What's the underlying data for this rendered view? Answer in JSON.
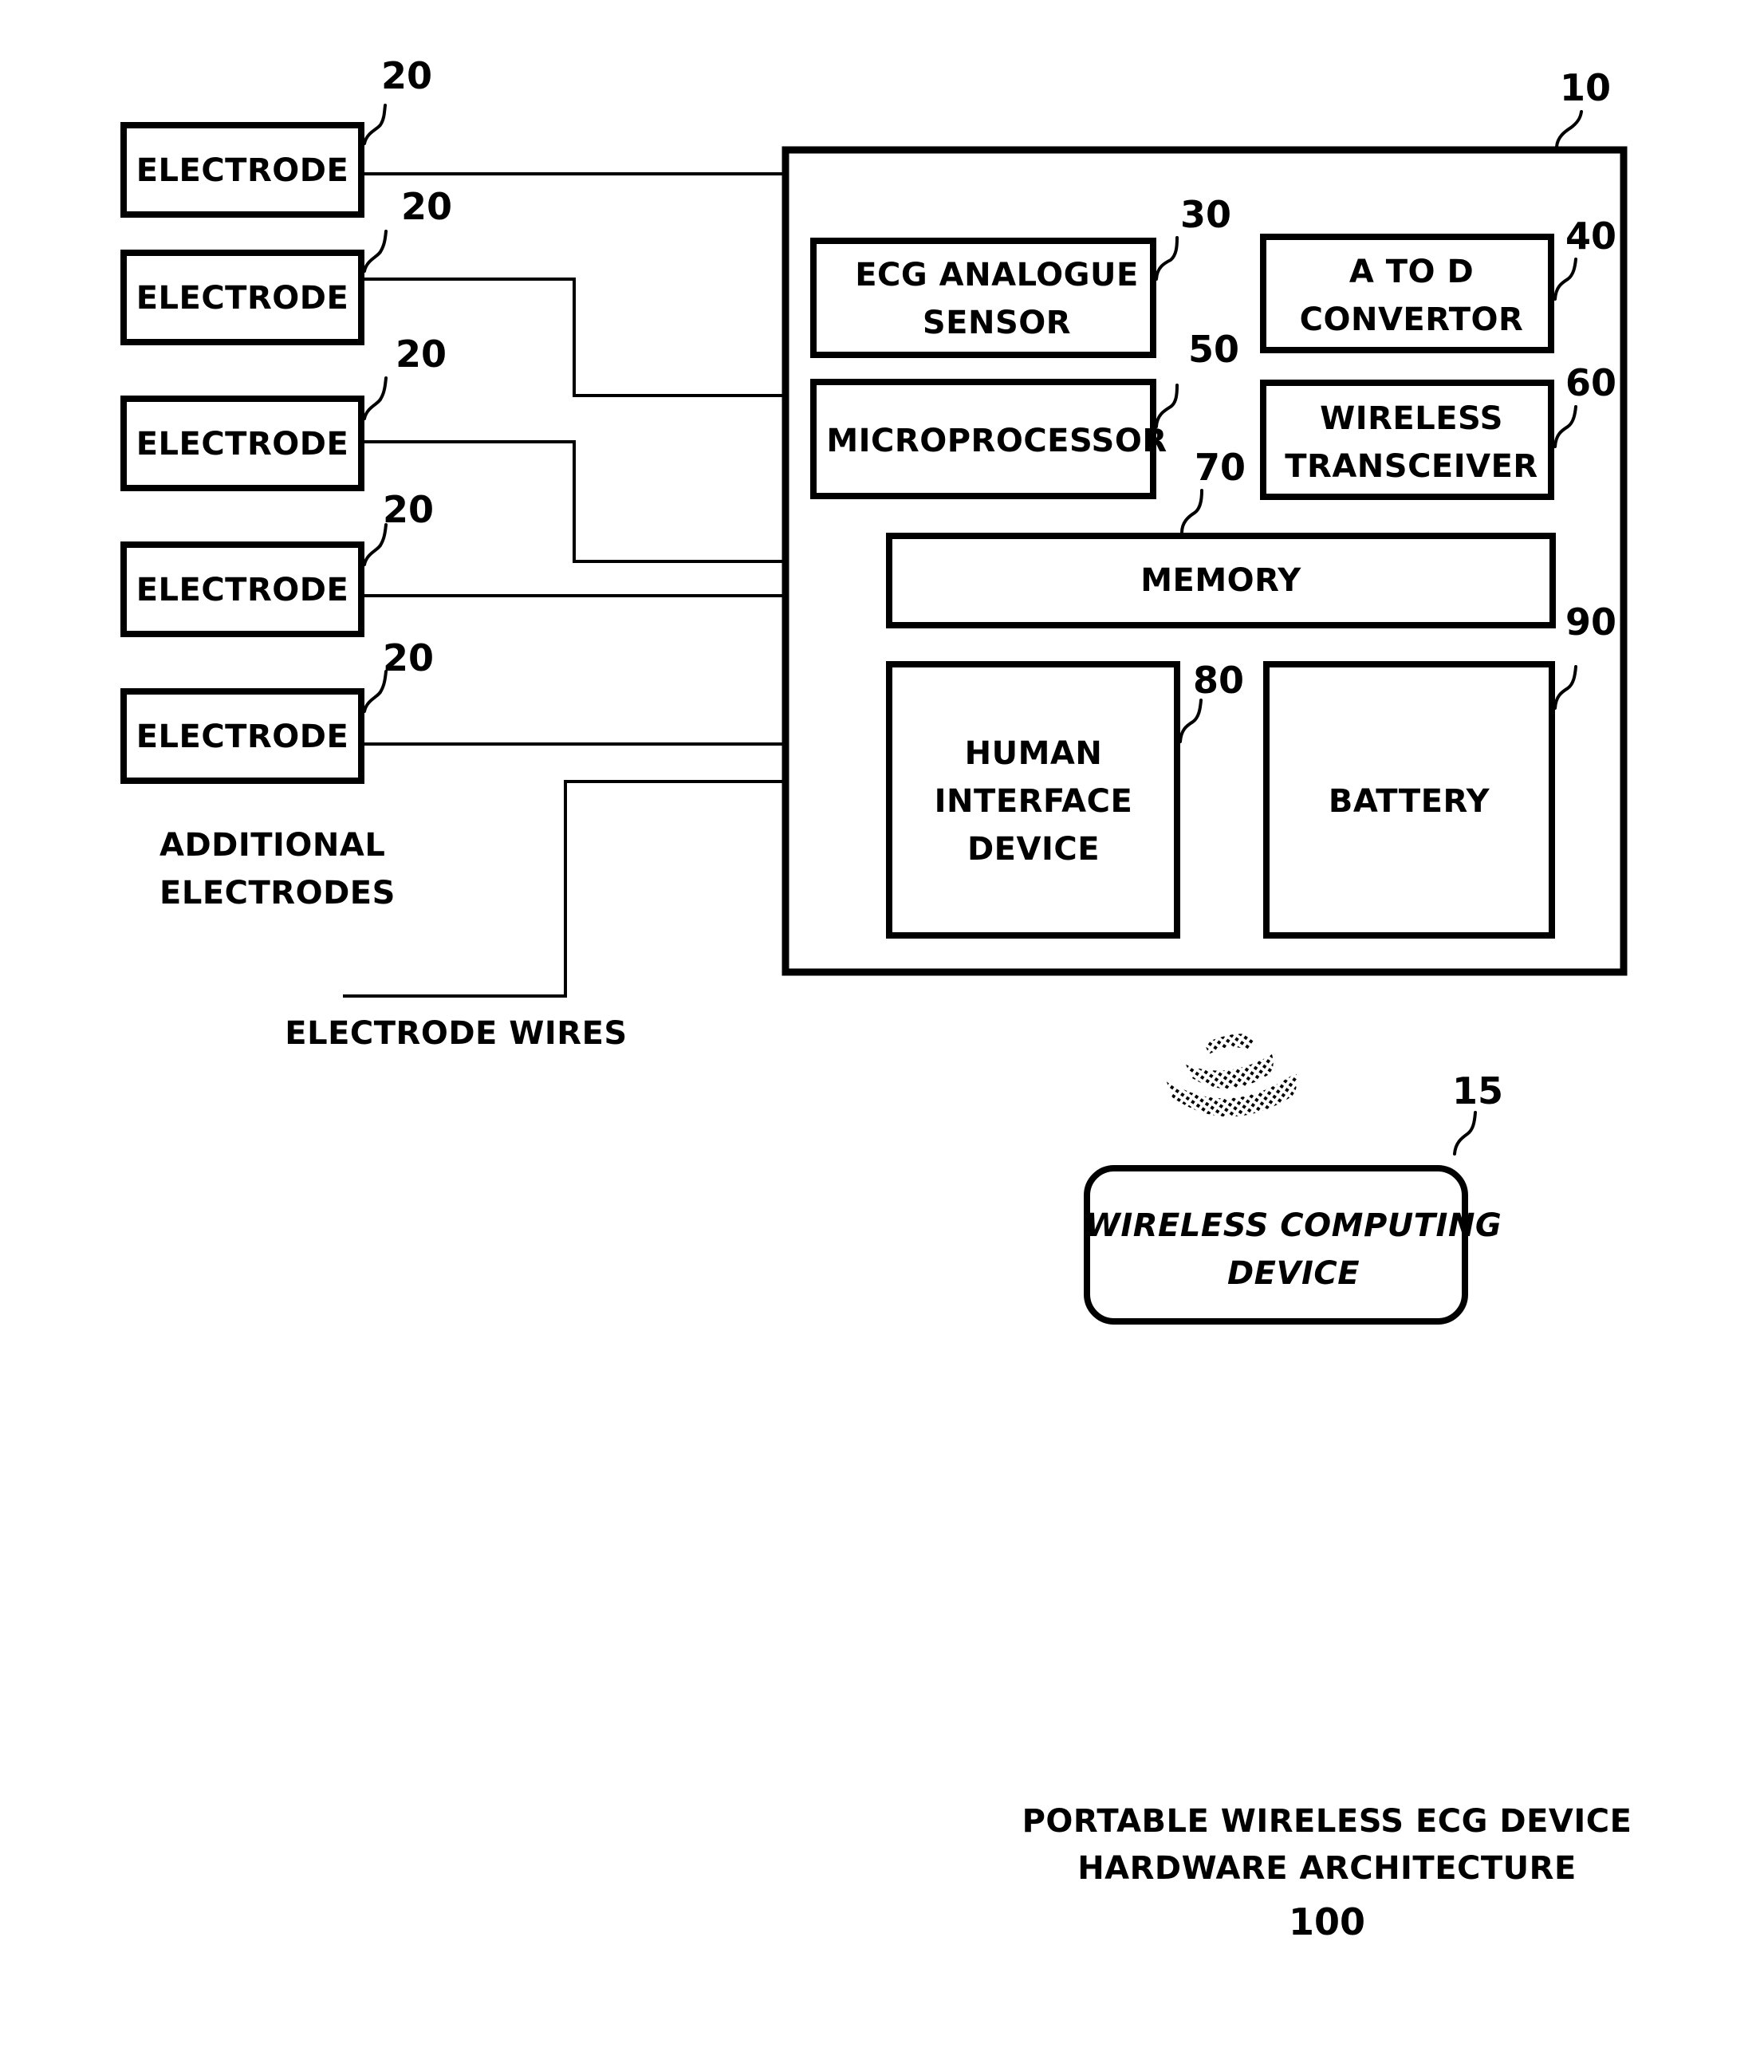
{
  "figure": {
    "caption_line1": "PORTABLE WIRELESS ECG DEVICE",
    "caption_line2": "HARDWARE ARCHITECTURE",
    "figure_number": "100"
  },
  "device": {
    "ref": "10",
    "components": [
      {
        "id": "ecg-analogue-sensor",
        "ref": "30",
        "lines": [
          "ECG ANALOGUE",
          "SENSOR"
        ]
      },
      {
        "id": "a-to-d-convertor",
        "ref": "40",
        "lines": [
          "A TO D",
          "CONVERTOR"
        ]
      },
      {
        "id": "microprocessor",
        "ref": "50",
        "lines": [
          "MICROPROCESSOR"
        ]
      },
      {
        "id": "wireless-transceiver",
        "ref": "60",
        "lines": [
          "WIRELESS",
          "TRANSCEIVER"
        ]
      },
      {
        "id": "memory",
        "ref": "70",
        "lines": [
          "MEMORY"
        ]
      },
      {
        "id": "human-interface-device",
        "ref": "80",
        "lines": [
          "HUMAN",
          "INTERFACE",
          "DEVICE"
        ]
      },
      {
        "id": "battery",
        "ref": "90",
        "lines": [
          "BATTERY"
        ]
      }
    ]
  },
  "electrodes": {
    "label": "ELECTRODE",
    "ref": "20",
    "count": 5,
    "additional_label_line1": "ADDITIONAL",
    "additional_label_line2": "ELECTRODES",
    "wires_label": "ELECTRODE WIRES"
  },
  "wireless_device": {
    "ref": "15",
    "line1": "WIRELESS COMPUTING",
    "line2": "DEVICE",
    "signal_icon": "wireless-signal-icon"
  }
}
